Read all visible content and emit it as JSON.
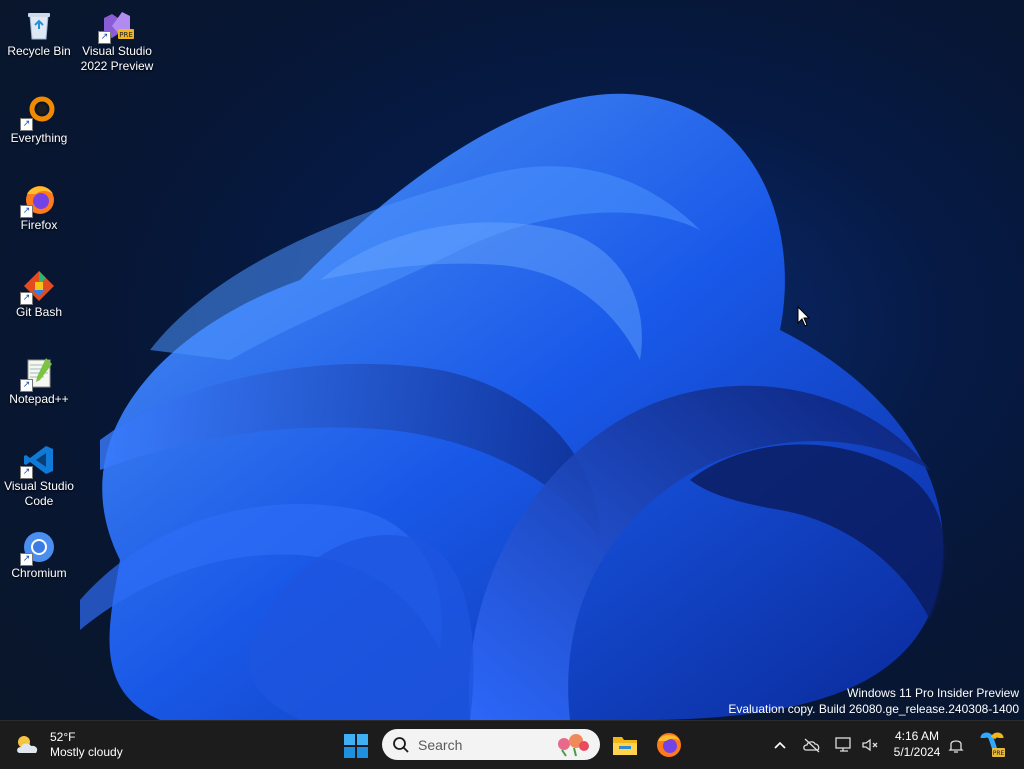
{
  "desktop": {
    "icons": [
      {
        "label": "Recycle Bin"
      },
      {
        "label": "Visual Studio 2022 Preview"
      },
      {
        "label": "Everything"
      },
      {
        "label": "Firefox"
      },
      {
        "label": "Git Bash"
      },
      {
        "label": "Notepad++"
      },
      {
        "label": "Visual Studio Code"
      },
      {
        "label": "Chromium"
      }
    ],
    "watermark": {
      "line1": "Windows 11 Pro Insider Preview",
      "line2": "Evaluation copy. Build 26080.ge_release.240308-1400"
    }
  },
  "taskbar": {
    "weather": {
      "temp": "52°F",
      "condition": "Mostly cloudy",
      "icon": "cloud-sun-icon"
    },
    "search": {
      "placeholder": "Search"
    },
    "pinned": [
      {
        "name": "file-explorer",
        "icon": "folder-icon"
      },
      {
        "name": "firefox",
        "icon": "firefox-icon"
      }
    ],
    "clock": {
      "time": "4:16 AM",
      "date": "5/1/2024"
    },
    "accent": "#0078d4"
  }
}
